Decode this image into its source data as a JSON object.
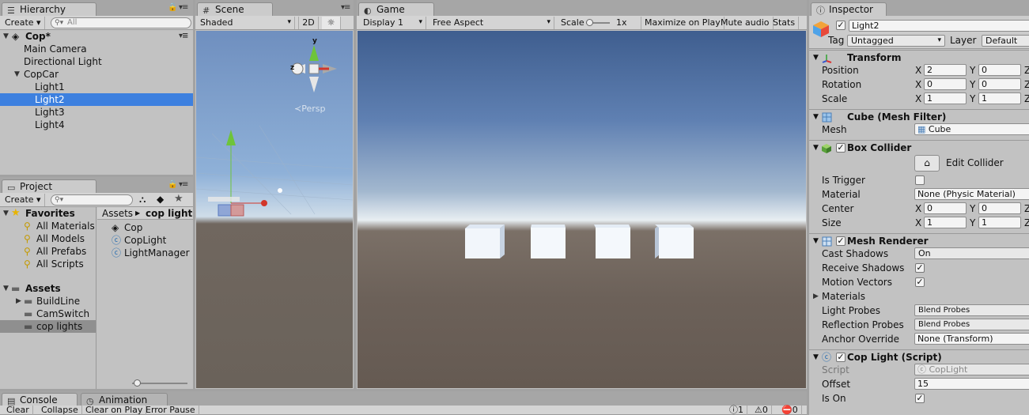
{
  "hierarchy": {
    "tab": "Hierarchy",
    "create": "Create",
    "search_placeholder": "All",
    "scene_name": "Cop*",
    "items": [
      "Main Camera",
      "Directional Light",
      "CopCar",
      "Light1",
      "Light2",
      "Light3",
      "Light4"
    ]
  },
  "project": {
    "tab": "Project",
    "create": "Create",
    "favorites_label": "Favorites",
    "favorites": [
      "All Materials",
      "All Models",
      "All Prefabs",
      "All Scripts"
    ],
    "assets_label": "Assets",
    "folders": [
      "BuildLine",
      "CamSwitch",
      "cop lights"
    ],
    "breadcrumb_root": "Assets",
    "breadcrumb_current": "cop lights",
    "files": [
      "Cop",
      "CopLight",
      "LightManager"
    ]
  },
  "scene": {
    "tab": "Scene",
    "shading": "Shaded",
    "mode2d": "2D",
    "persp": "Persp",
    "axis_y": "y",
    "axis_z": "z"
  },
  "game": {
    "tab": "Game",
    "display": "Display 1",
    "aspect": "Free Aspect",
    "scale_label": "Scale",
    "scale_value": "1x",
    "maximize": "Maximize on Play",
    "mute": "Mute audio",
    "stats": "Stats"
  },
  "inspector": {
    "tab": "Inspector",
    "object_name": "Light2",
    "tag_label": "Tag",
    "tag_value": "Untagged",
    "layer_label": "Layer",
    "layer_value": "Default",
    "transform": {
      "title": "Transform",
      "position_label": "Position",
      "position_x": "2",
      "position_y": "0",
      "rotation_label": "Rotation",
      "rotation_x": "0",
      "rotation_y": "0",
      "scale_label": "Scale",
      "scale_x": "1",
      "scale_y": "1"
    },
    "mesh_filter": {
      "title": "Cube (Mesh Filter)",
      "mesh_label": "Mesh",
      "mesh_value": "Cube"
    },
    "box_collider": {
      "title": "Box Collider",
      "edit_label": "Edit Collider",
      "is_trigger_label": "Is Trigger",
      "material_label": "Material",
      "material_value": "None (Physic Material)",
      "center_label": "Center",
      "center_x": "0",
      "center_y": "0",
      "size_label": "Size",
      "size_x": "1",
      "size_y": "1"
    },
    "mesh_renderer": {
      "title": "Mesh Renderer",
      "cast_shadows_label": "Cast Shadows",
      "cast_shadows_value": "On",
      "receive_shadows_label": "Receive Shadows",
      "motion_vectors_label": "Motion Vectors",
      "materials_label": "Materials",
      "light_probes_label": "Light Probes",
      "light_probes_value": "Blend Probes",
      "reflection_probes_label": "Reflection Probes",
      "reflection_probes_value": "Blend Probes",
      "anchor_override_label": "Anchor Override",
      "anchor_override_value": "None (Transform)"
    },
    "cop_light": {
      "title": "Cop Light (Script)",
      "script_label": "Script",
      "script_value": "CopLight",
      "offset_label": "Offset",
      "offset_value": "15",
      "is_on_label": "Is On"
    }
  },
  "console": {
    "tab": "Console",
    "animation_tab": "Animation",
    "clear": "Clear",
    "collapse": "Collapse",
    "clear_on_play": "Clear on Play",
    "error_pause": "Error Pause",
    "count_info": "1",
    "count_warn": "0",
    "count_error": "0"
  },
  "icons": {
    "selection_blue": "#3d80df"
  }
}
